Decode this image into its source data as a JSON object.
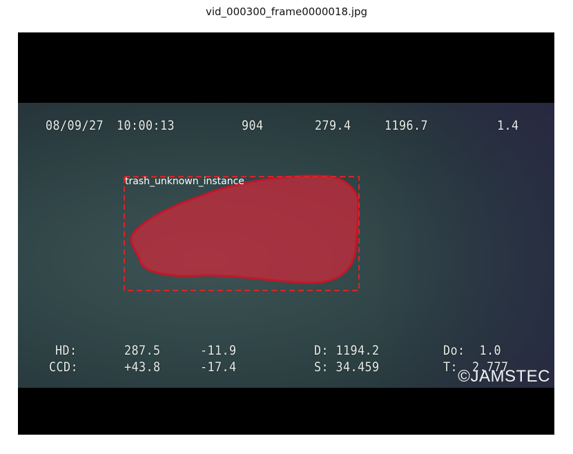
{
  "title": "vid_000300_frame0000018.jpg",
  "osd": {
    "date": "08/09/27",
    "time": "10:00:13",
    "top_v1": "904",
    "top_v2": "279.4",
    "top_v3": "1196.7",
    "top_v4": "1.4",
    "hd_label": "HD:",
    "hd_v1": "287.5",
    "hd_v2": "-11.9",
    "d_label": "D: 1194.2",
    "do_label": "Do:  1.0",
    "ccd_label": "CCD:",
    "ccd_v1": "+43.8",
    "ccd_v2": "-17.4",
    "s_label": "S: 34.459",
    "t_label": "T:  2.777"
  },
  "detection": {
    "label": "trash_unknown_instance",
    "mask_color": "#d0283a",
    "box_color": "#d62728"
  },
  "watermark": "©JAMSTEC"
}
